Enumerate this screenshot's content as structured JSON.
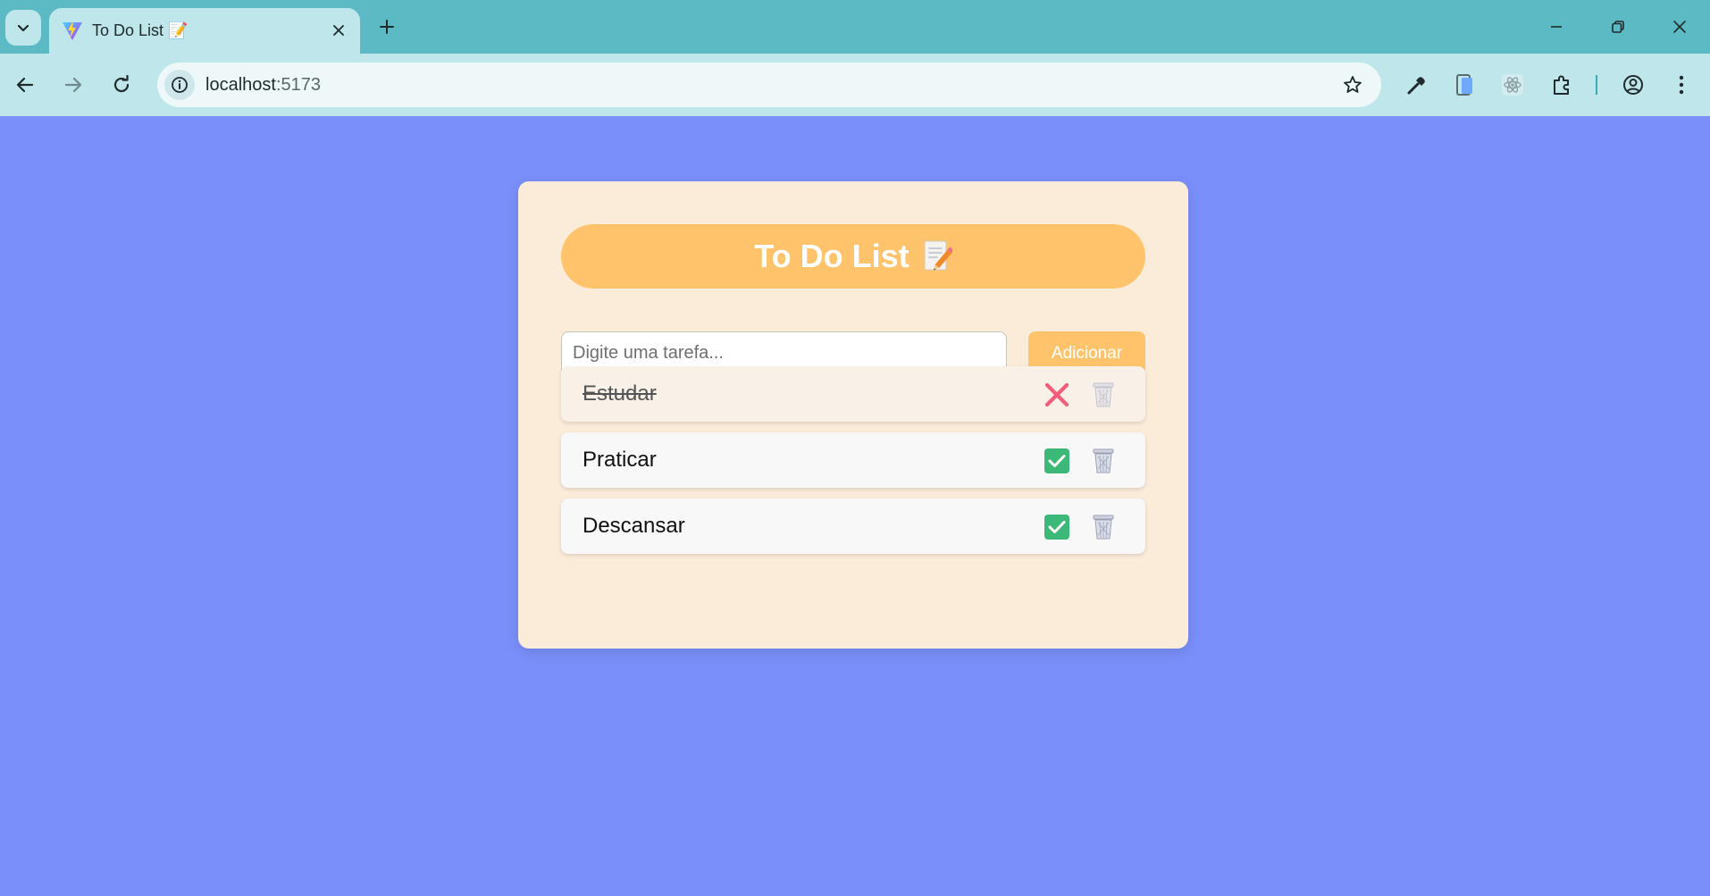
{
  "browser": {
    "tab_title": "To Do List 📝",
    "url_host": "localhost",
    "url_port": ":5173"
  },
  "app": {
    "title": "To Do List",
    "title_icon": "memo-icon",
    "input_placeholder": "Digite uma tarefa...",
    "input_value": "",
    "add_label": "Adicionar",
    "tasks": [
      {
        "label": "Estudar",
        "completed": true,
        "toggle_icon": "cross-mark-icon",
        "delete_icon": "trash-icon"
      },
      {
        "label": "Praticar",
        "completed": false,
        "toggle_icon": "check-mark-icon",
        "delete_icon": "trash-icon"
      },
      {
        "label": "Descansar",
        "completed": false,
        "toggle_icon": "check-mark-icon",
        "delete_icon": "trash-icon"
      }
    ]
  },
  "colors": {
    "page_background": "#7a8ffa",
    "card_background": "#fbebd9",
    "accent": "#ffc46b",
    "check": "#3cb878",
    "cross": "#f45d7a"
  }
}
